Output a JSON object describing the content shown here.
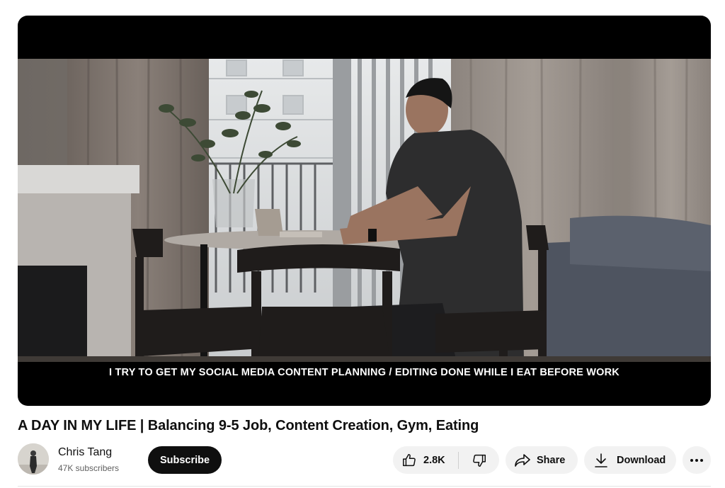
{
  "video": {
    "caption": "I TRY TO GET MY SOCIAL MEDIA CONTENT PLANNING / EDITING DONE WHILE I EAT BEFORE WORK"
  },
  "title": "A DAY IN MY LIFE | Balancing 9-5 Job, Content Creation, Gym, Eating",
  "channel": {
    "name": "Chris Tang",
    "subscribers": "47K subscribers",
    "subscribe_label": "Subscribe"
  },
  "actions": {
    "like_count": "2.8K",
    "share_label": "Share",
    "download_label": "Download"
  },
  "icons": {
    "like": "thumbs-up-icon",
    "dislike": "thumbs-down-icon",
    "share": "share-arrow-icon",
    "download": "download-icon",
    "more": "more-horizontal-icon"
  }
}
